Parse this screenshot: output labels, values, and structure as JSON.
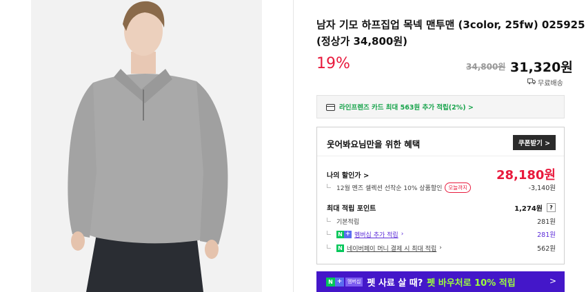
{
  "product": {
    "title_line1": "남자 기모 하프집업 목넥 맨투맨 (3color, 25fw) 025925",
    "title_line2": "(정상가 34,800원)",
    "discount_rate": "19%",
    "original_price": "34,800원",
    "sale_price": "31,320원",
    "shipping": "무료배송"
  },
  "card_offer": {
    "text": "라인프렌즈 카드 최대 563원 추가 적립(2%) >"
  },
  "benefit": {
    "title": "웃어봐요님만을 위한 혜택",
    "coupon_button": "쿠폰받기 >",
    "my_price_label": "나의 할인가 >",
    "my_price_value": "28,180원",
    "coupon_desc": "12월 멘즈 셀렉션 선착순 10% 상품할인",
    "today_badge": "오늘까지",
    "coupon_discount": "-3,140원",
    "points_label": "최대 적립 포인트",
    "points_value": "1,274원",
    "points_help": "?",
    "basic_label": "기본적립",
    "basic_value": "281원",
    "membership_label": "멤버십 추가 적립",
    "membership_value": "281원",
    "npay_label": "네이버페이 머니 결제 시 최대 적립",
    "npay_value": "562원"
  },
  "banner": {
    "n_badge": "N",
    "plus_badge": "+",
    "membership_badge": "멤버십",
    "text1": "펫 사료 살 때?",
    "text2": "펫 바우처로 10% 적립",
    "arrow": ">"
  },
  "colors": {
    "discount_red": "#e8193c",
    "card_green": "#16a34a",
    "banner_purple": "#4417c9",
    "banner_highlight": "#9cff3c",
    "naver_green": "#03c75a"
  },
  "icons": {
    "shipping": "truck-icon",
    "card": "credit-card-icon",
    "banner_arrow": "chevron-right-icon"
  }
}
